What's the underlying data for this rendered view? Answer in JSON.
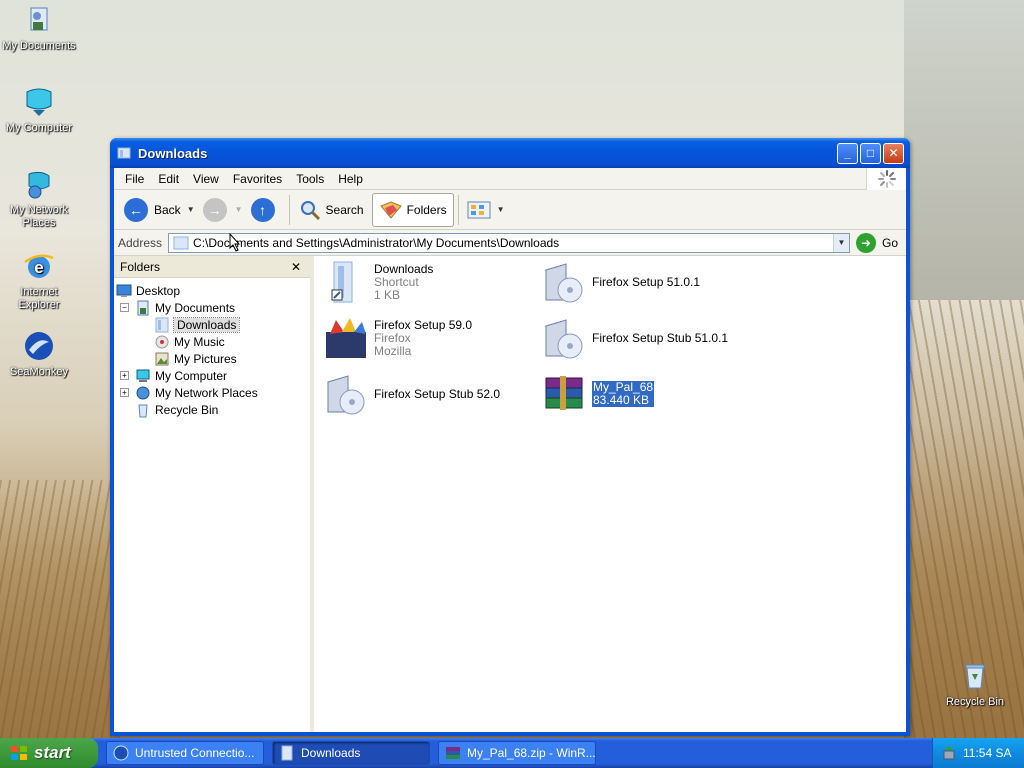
{
  "desktop": {
    "icons": [
      {
        "label": "My Documents",
        "icon": "my-documents-icon"
      },
      {
        "label": "My Computer",
        "icon": "my-computer-icon"
      },
      {
        "label": "My Network Places",
        "icon": "network-places-icon"
      },
      {
        "label": "Internet Explorer",
        "icon": "internet-explorer-icon"
      },
      {
        "label": "SeaMonkey",
        "icon": "seamonkey-icon"
      },
      {
        "label": "Recycle Bin",
        "icon": "recycle-bin-icon"
      }
    ]
  },
  "window": {
    "title": "Downloads",
    "menu": [
      "File",
      "Edit",
      "View",
      "Favorites",
      "Tools",
      "Help"
    ],
    "toolbar": {
      "back_label": "Back",
      "search_label": "Search",
      "folders_label": "Folders"
    },
    "address": {
      "label": "Address",
      "value": "C:\\Documents and Settings\\Administrator\\My Documents\\Downloads",
      "go_label": "Go"
    },
    "folders_pane": {
      "title": "Folders",
      "tree": [
        {
          "label": "Desktop"
        },
        {
          "label": "My Documents"
        },
        {
          "label": "Downloads"
        },
        {
          "label": "My Music"
        },
        {
          "label": "My Pictures"
        },
        {
          "label": "My Computer"
        },
        {
          "label": "My Network Places"
        },
        {
          "label": "Recycle Bin"
        }
      ]
    },
    "files": [
      {
        "name": "Downloads",
        "line2": "Shortcut",
        "line3": "1 KB"
      },
      {
        "name": "Firefox Setup 51.0.1",
        "line2": "",
        "line3": ""
      },
      {
        "name": "Firefox Setup 59.0",
        "line2": "Firefox",
        "line3": "Mozilla"
      },
      {
        "name": "Firefox Setup Stub 51.0.1",
        "line2": "",
        "line3": ""
      },
      {
        "name": "Firefox Setup Stub 52.0",
        "line2": "",
        "line3": ""
      },
      {
        "name": "My_Pal_68",
        "line2": "83.440 KB",
        "line3": ""
      }
    ]
  },
  "taskbar": {
    "start_label": "start",
    "tasks": [
      {
        "label": "Untrusted Connectio..."
      },
      {
        "label": "Downloads"
      },
      {
        "label": "My_Pal_68.zip - WinR..."
      }
    ],
    "clock": "11:54 SA"
  },
  "colors": {
    "titlebar": "#0554db",
    "selection": "#316ac5",
    "start_green": "#3c9b3a",
    "taskbar_blue": "#245edb"
  }
}
